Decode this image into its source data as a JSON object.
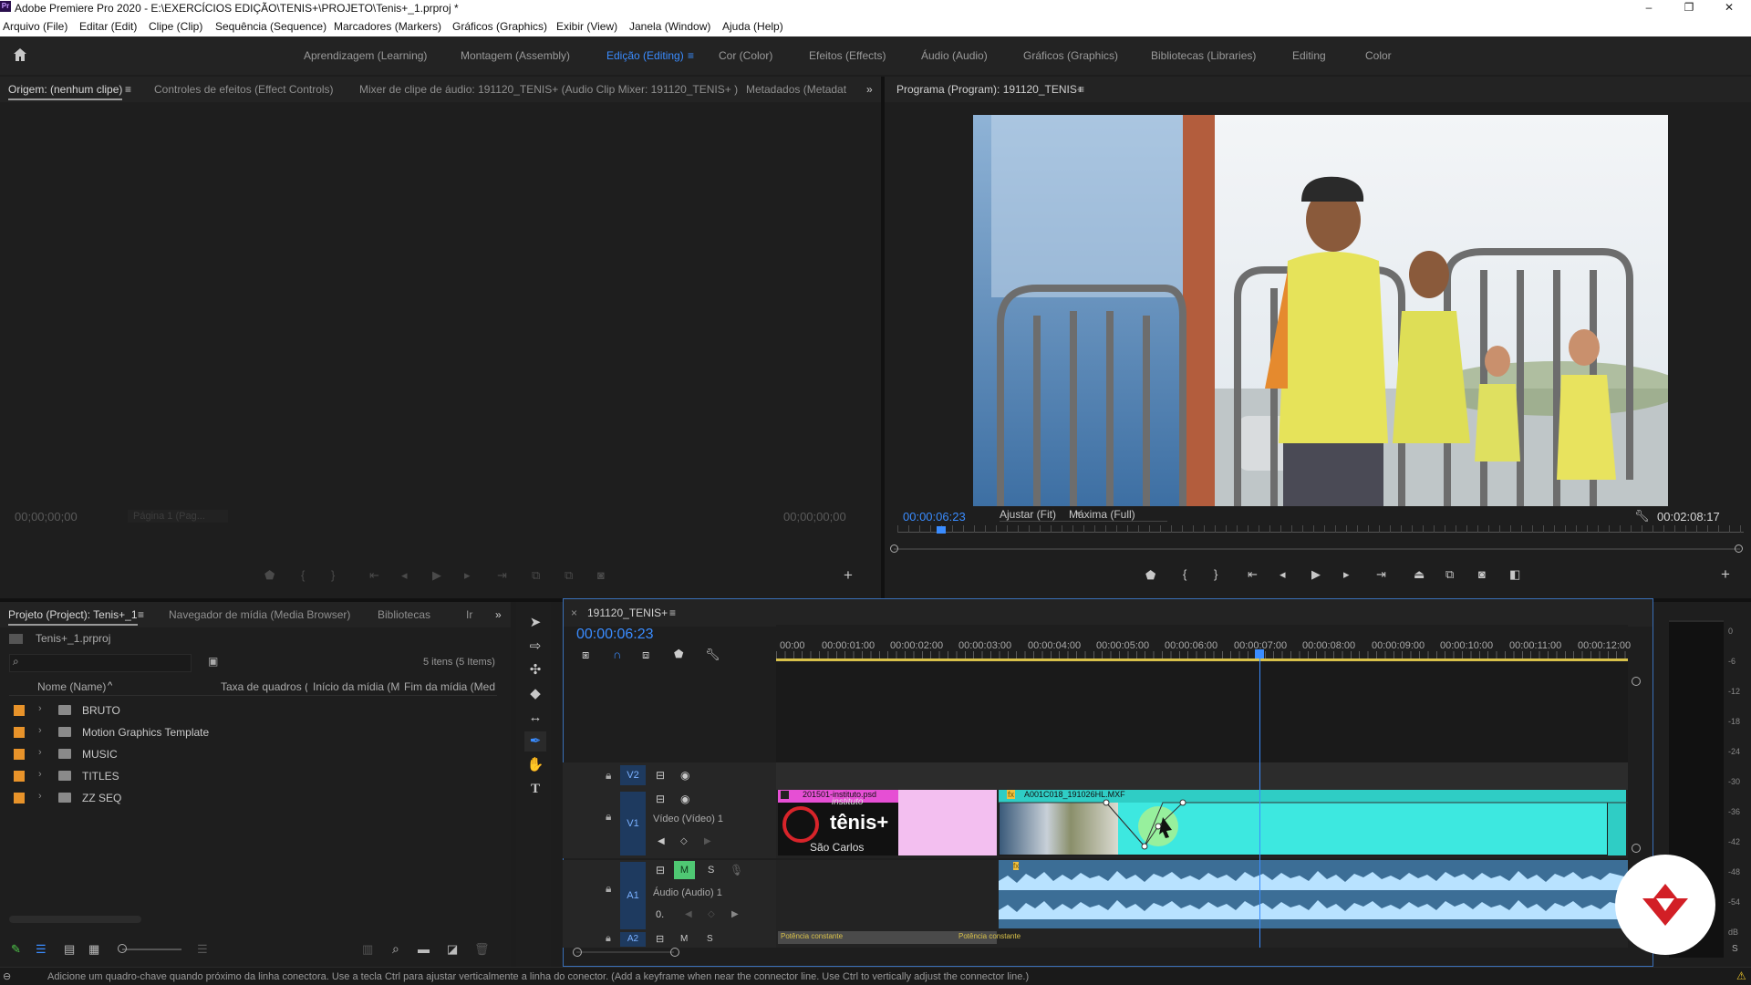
{
  "app": {
    "title": "Adobe Premiere Pro 2020 - E:\\EXERCÍCIOS EDIÇÃO\\TENIS+\\PROJETO\\Tenis+_1.prproj *",
    "logo_text": "Pr",
    "window_buttons": [
      "–",
      "❐",
      "✕"
    ]
  },
  "menu": [
    "Arquivo (File)",
    "Editar (Edit)",
    "Clipe (Clip)",
    "Sequência (Sequence)",
    "Marcadores (Markers)",
    "Gráficos (Graphics)",
    "Exibir (View)",
    "Janela (Window)",
    "Ajuda (Help)"
  ],
  "workspaces": {
    "items": [
      "Aprendizagem (Learning)",
      "Montagem (Assembly)",
      "Edição (Editing)",
      "Cor (Color)",
      "Efeitos (Effects)",
      "Áudio (Audio)",
      "Gráficos (Graphics)",
      "Bibliotecas (Libraries)",
      "Editing",
      "Color"
    ],
    "active": "Edição (Editing)",
    "overflow": "»"
  },
  "source_panel": {
    "tabs": [
      "Origem: (nenhum clipe)",
      "Controles de efeitos (Effect Controls)",
      "Mixer de clipe de áudio: 191120_TENIS+  (Audio Clip Mixer: 191120_TENIS+ )",
      "Metadados (Metadata"
    ],
    "menu_glyph": "≡",
    "timecode_left": "00;00;00;00",
    "page_select": "Página 1 (Pag...",
    "timecode_right": "00;00;00;00",
    "add_glyph": "+"
  },
  "program_panel": {
    "tab": "Programa (Program): 191120_TENIS+",
    "menu_glyph": "≡",
    "timecode": "00:00:06:23",
    "fit": "Ajustar (Fit)",
    "quality": "Máxima (Full)",
    "duration": "00:02:08:17",
    "add_glyph": "+"
  },
  "project_panel": {
    "tabs": [
      "Projeto (Project): Tenis+_1",
      "Navegador de mídia (Media Browser)",
      "Bibliotecas",
      "Ir"
    ],
    "menu_glyph": "≡",
    "overflow": "»",
    "project_file": "Tenis+_1.prproj",
    "items_count": "5 itens (5 Items)",
    "columns": [
      "Nome (Name)",
      "Taxa de quadros (F",
      "Início da mídia (M",
      "Fim da mídia (Med"
    ],
    "sort_glyph": "^",
    "chevron": "›",
    "rows": [
      "BRUTO",
      "Motion Graphics Template",
      "MUSIC",
      "TITLES",
      "ZZ SEQ"
    ],
    "swatch_color": "#e8932a"
  },
  "timeline": {
    "close_glyph": "×",
    "sequence_tab": "191120_TENIS+",
    "menu_glyph": "≡",
    "timecode": "00:00:06:23",
    "ruler": [
      "00:00",
      "00:00:01:00",
      "00:00:02:00",
      "00:00:03:00",
      "00:00:04:00",
      "00:00:05:00",
      "00:00:06:00",
      "00:00:07:00",
      "00:00:08:00",
      "00:00:09:00",
      "00:00:10:00",
      "00:00:11:00",
      "00:00:12:00"
    ],
    "tracks": {
      "v2": "V2",
      "v1": "V1",
      "v1_name": "Vídeo (Vídeo) 1",
      "a1": "A1",
      "a1_name": "Áudio (Audio) 1",
      "a2": "A2",
      "m": "M",
      "s": "S",
      "keyframe_value": "0.",
      "fx_badge": "fx"
    },
    "clips": {
      "clip1": "201501-instituto.psd",
      "clip1_title": "tênis+",
      "clip1_sub": "São Carlos",
      "clip1_small": "instituto",
      "clip2": "A001C018_191026HL.MXF",
      "audio_transition1": "Potência constante",
      "audio_transition2": "Potência constante"
    },
    "accent_color": "#3a8cff",
    "clip_video_color": "#3de8e0",
    "clip_pink_color": "#f3bff0"
  },
  "meter": {
    "labels": [
      "0",
      "-6",
      "-12",
      "-18",
      "-24",
      "-30",
      "-36",
      "-42",
      "-48",
      "-54",
      "dB"
    ],
    "solo": "S"
  },
  "status_bar": "Adicione um quadro-chave quando próximo da linha conectora. Use a tecla Ctrl para ajustar verticalmente a linha do conector. (Add a keyframe when near the connector line. Use Ctrl to vertically adjust the connector line.)"
}
